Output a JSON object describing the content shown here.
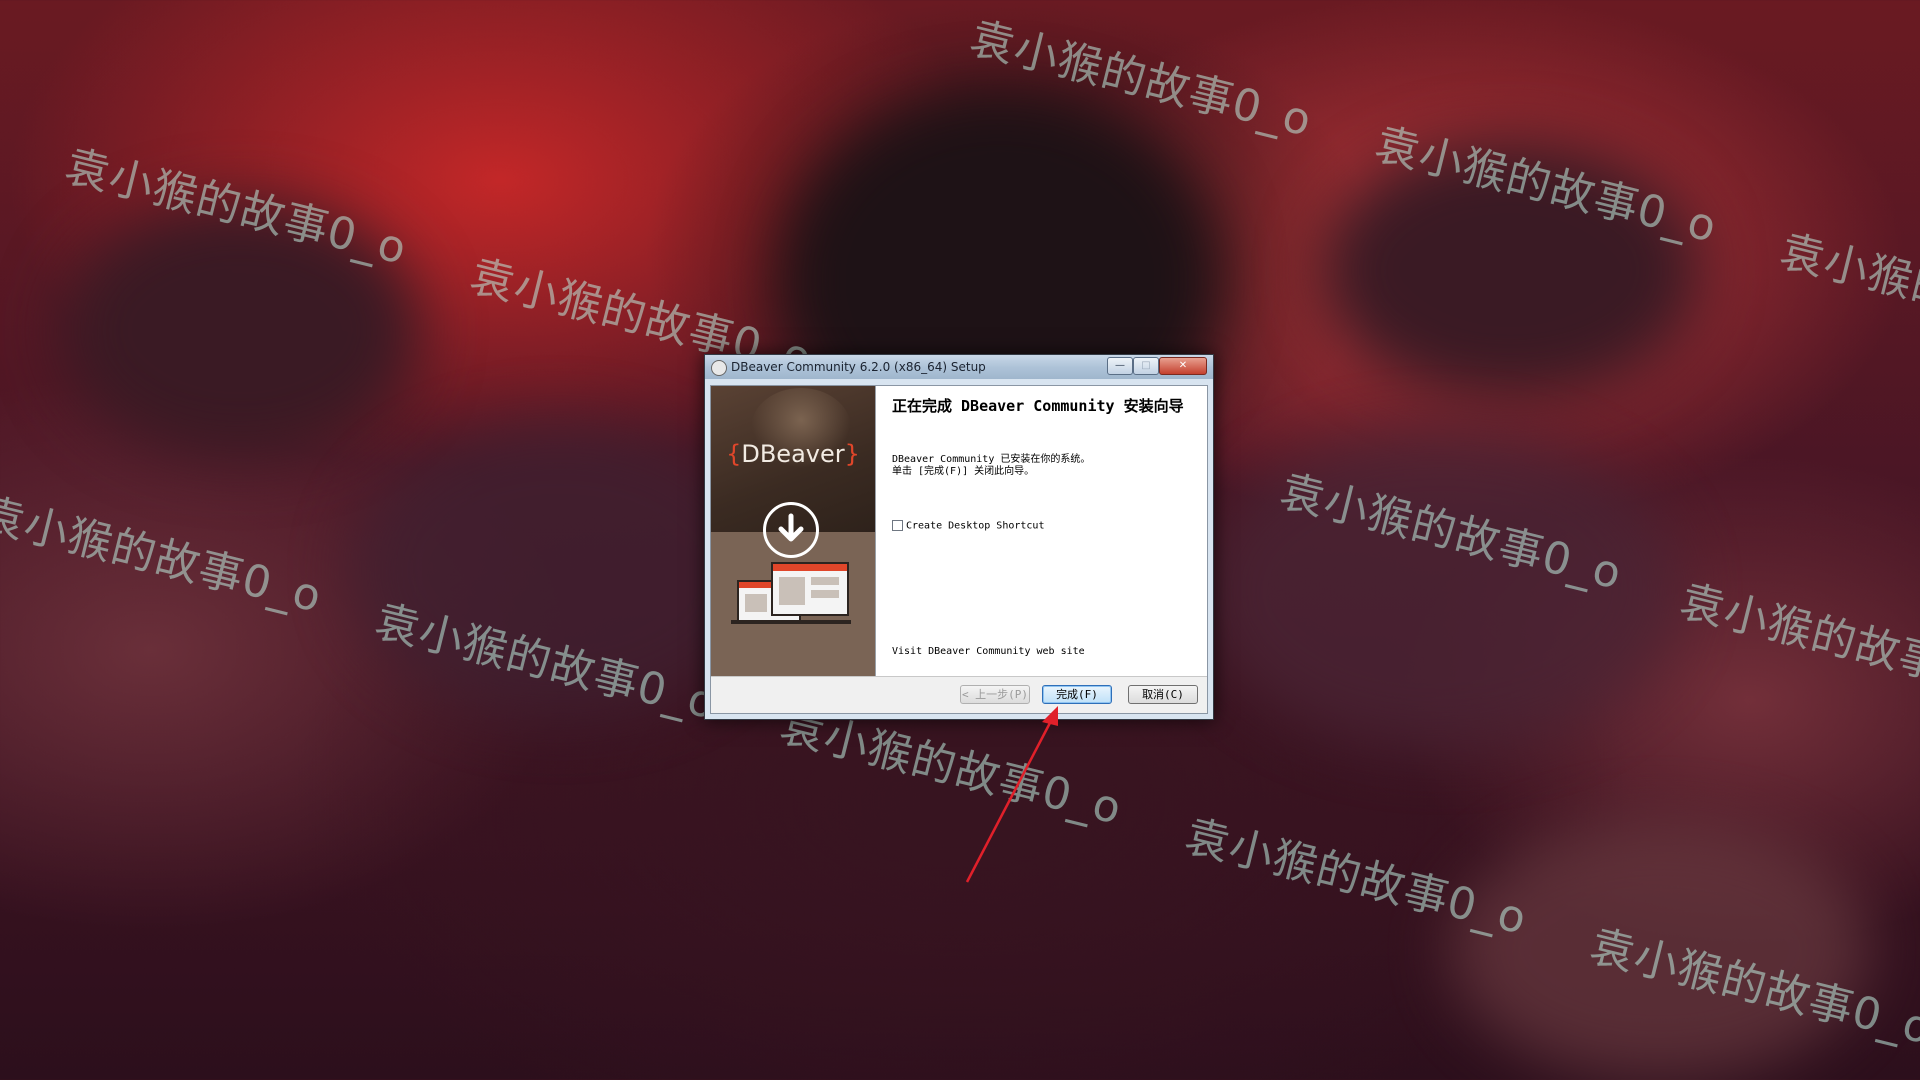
{
  "window": {
    "title": "DBeaver Community 6.2.0 (x86_64) Setup",
    "minimize_label": "—",
    "maximize_label": "□",
    "close_label": "✕"
  },
  "sidebar": {
    "brand_left": "{",
    "brand_name": "DBeaver",
    "brand_right": "}"
  },
  "content": {
    "heading": "正在完成 DBeaver Community 安装向导",
    "message_line1": "DBeaver Community 已安装在你的系统。",
    "message_line2": "单击 [完成(F)] 关闭此向导。",
    "checkbox_label": "Create Desktop Shortcut",
    "visit_link": "Visit DBeaver Community web site"
  },
  "buttons": {
    "back": "< 上一步(P)",
    "finish": "完成(F)",
    "cancel": "取消(C)"
  },
  "watermark": {
    "text": "袁小猴的故事0_o"
  },
  "colors": {
    "annotation_arrow": "#e0202a",
    "brand_accent": "#e0462a"
  }
}
